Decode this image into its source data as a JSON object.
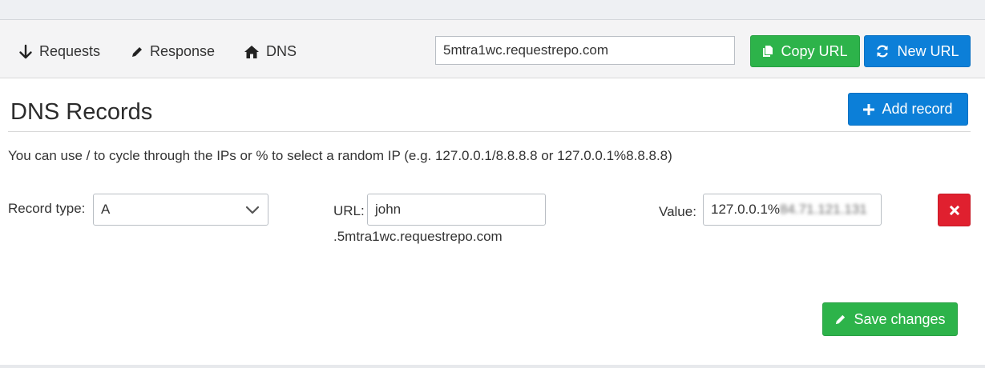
{
  "nav": {
    "requests_label": "Requests",
    "response_label": "Response",
    "dns_label": "DNS",
    "url_value": "5mtra1wc.requestrepo.com",
    "copy_url_label": "Copy URL",
    "new_url_label": "New URL"
  },
  "page": {
    "title": "DNS Records",
    "add_record_label": "Add record",
    "hint": "You can use / to cycle through the IPs or % to select a random IP (e.g. 127.0.0.1/8.8.8.8 or 127.0.0.1%8.8.8.8)",
    "save_label": "Save changes"
  },
  "record": {
    "type_label": "Record type:",
    "type_value": "A",
    "url_label": "URL:",
    "url_value": "john",
    "url_suffix": ".5mtra1wc.requestrepo.com",
    "value_label": "Value:",
    "value_visible": "127.0.0.1%",
    "value_obscured": "84.71.121.131"
  },
  "colors": {
    "green": "#2db34a",
    "blue": "#0c7fd8",
    "red": "#e0202f"
  }
}
